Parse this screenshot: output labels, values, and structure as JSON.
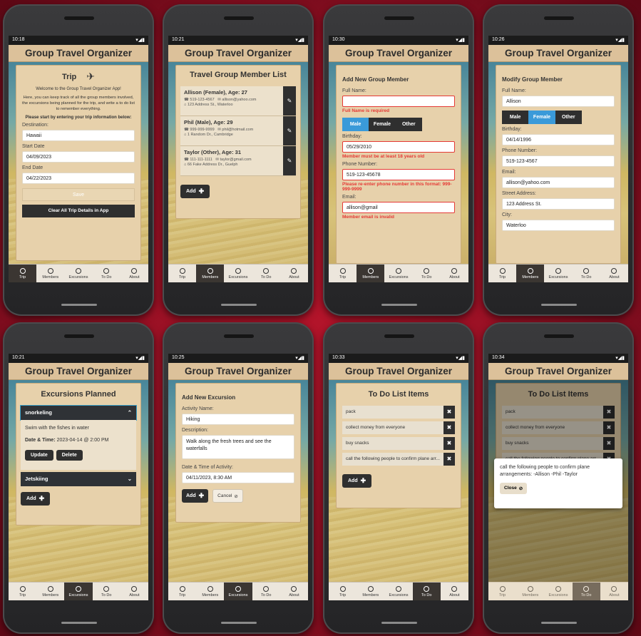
{
  "app": {
    "title": "Group Travel Organizer"
  },
  "tabs": [
    "Trip",
    "Members",
    "Excursions",
    "To Do",
    "About"
  ],
  "phones": [
    {
      "time": "10:18",
      "active_tab": 0
    },
    {
      "time": "10:21",
      "active_tab": 1
    },
    {
      "time": "10:30",
      "active_tab": 1
    },
    {
      "time": "10:26",
      "active_tab": 1
    },
    {
      "time": "10:21",
      "active_tab": 2
    },
    {
      "time": "10:25",
      "active_tab": 2
    },
    {
      "time": "10:33",
      "active_tab": 3
    },
    {
      "time": "10:34",
      "active_tab": 3
    }
  ],
  "trip": {
    "title": "Trip",
    "welcome": "Welcome to the Group Travel Organizer App!",
    "intro": "Here, you can keep track of all the group members involved, the excursions being planned for the trip, and write a to do list to remember everything.",
    "prompt": "Please start by entering your trip information below:",
    "destination_label": "Destination:",
    "destination": "Hawaii",
    "start_label": "Start Date",
    "start": "04/09/2023",
    "end_label": "End Date",
    "end": "04/22/2023",
    "save": "Save",
    "clear": "Clear All Trip Details in App"
  },
  "members": {
    "title": "Travel Group Member List",
    "list": [
      {
        "name": "Allison (Female), Age: 27",
        "phone": "519-123-4567",
        "email": "allison@yahoo.com",
        "address": "123 Address St., Waterloo"
      },
      {
        "name": "Phil (Male), Age: 29",
        "phone": "999-999-9999",
        "email": "phil@hotmail.com",
        "address": "1 Random Dr., Cambridge"
      },
      {
        "name": "Taylor (Other), Age: 31",
        "phone": "111-111-1111",
        "email": "taylor@gmail.com",
        "address": "66 Fake Address Dr., Guelph"
      }
    ],
    "add": "Add"
  },
  "add_member": {
    "title": "Add New Group Member",
    "fullname_label": "Full Name:",
    "fullname_err": "Full Name is required",
    "genders": [
      "Male",
      "Female",
      "Other"
    ],
    "birthday_label": "Birthday:",
    "birthday": "05/29/2010",
    "birthday_err": "Member must be at least 18 years old",
    "phone_label": "Phone Number:",
    "phone": "519-123-45678",
    "phone_err": "Please re-enter phone number in this format: 999-999-9999",
    "email_label": "Email:",
    "email": "allison@gmail",
    "email_err": "Member email is invalid"
  },
  "modify_member": {
    "title": "Modify Group Member",
    "fullname_label": "Full Name:",
    "fullname": "Allison",
    "birthday_label": "Birthday:",
    "birthday": "04/14/1996",
    "phone_label": "Phone Number:",
    "phone": "519-123-4567",
    "email_label": "Email:",
    "email": "allison@yahoo.com",
    "street_label": "Street Address:",
    "street": "123 Address St.",
    "city_label": "City:",
    "city": "Waterloo"
  },
  "excursions": {
    "title": "Excursions Planned",
    "items": [
      {
        "name": "snorkeling",
        "desc": "Swim with the fishes in water",
        "dt_label": "Date & Time:",
        "dt": "2023-04-14 @ 2:00 PM"
      },
      {
        "name": "Jetskiing"
      }
    ],
    "update": "Update",
    "delete": "Delete",
    "add": "Add"
  },
  "add_excursion": {
    "title": "Add New Excursion",
    "activity_label": "Activity Name:",
    "activity": "Hiking",
    "desc_label": "Description:",
    "desc": "Walk along the fresh trees and see the waterfalls",
    "dt_label": "Date & Time of Activity:",
    "dt": "04/11/2023, 8:30 AM",
    "add": "Add",
    "cancel": "Cancel"
  },
  "todo": {
    "title": "To Do List Items",
    "items": [
      "pack",
      "collect money from everyone",
      "buy snacks",
      "call the following people to confirm plane arr..."
    ],
    "add": "Add",
    "modal_text": "call the following people to confirm plane arrangements: -Allison -Phil -Taylor",
    "close": "Close"
  }
}
